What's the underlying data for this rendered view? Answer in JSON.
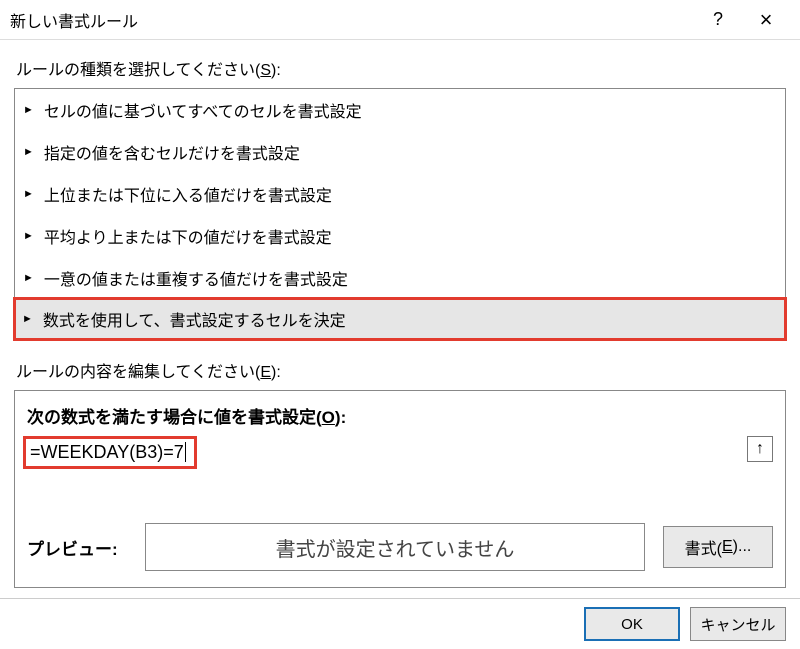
{
  "titlebar": {
    "title": "新しい書式ルール",
    "help": "?",
    "close": "×"
  },
  "ruleType": {
    "label_pre": "ルールの種類を選択してください(",
    "accel": "S",
    "label_post": "):",
    "items": [
      "セルの値に基づいてすべてのセルを書式設定",
      "指定の値を含むセルだけを書式設定",
      "上位または下位に入る値だけを書式設定",
      "平均より上または下の値だけを書式設定",
      "一意の値または重複する値だけを書式設定",
      "数式を使用して、書式設定するセルを決定"
    ]
  },
  "editRule": {
    "label_pre": "ルールの内容を編集してください(",
    "accel": "E",
    "label_post": "):",
    "heading_pre": "次の数式を満たす場合に値を書式設定(",
    "heading_accel": "O",
    "heading_post": "):",
    "formula": "=WEEKDAY(B3)=7",
    "collapse_icon": "↑"
  },
  "preview": {
    "label": "プレビュー:",
    "text": "書式が設定されていません",
    "format_btn_pre": "書式(",
    "format_btn_accel": "E",
    "format_btn_post": ")..."
  },
  "footer": {
    "ok": "OK",
    "cancel": "キャンセル"
  }
}
